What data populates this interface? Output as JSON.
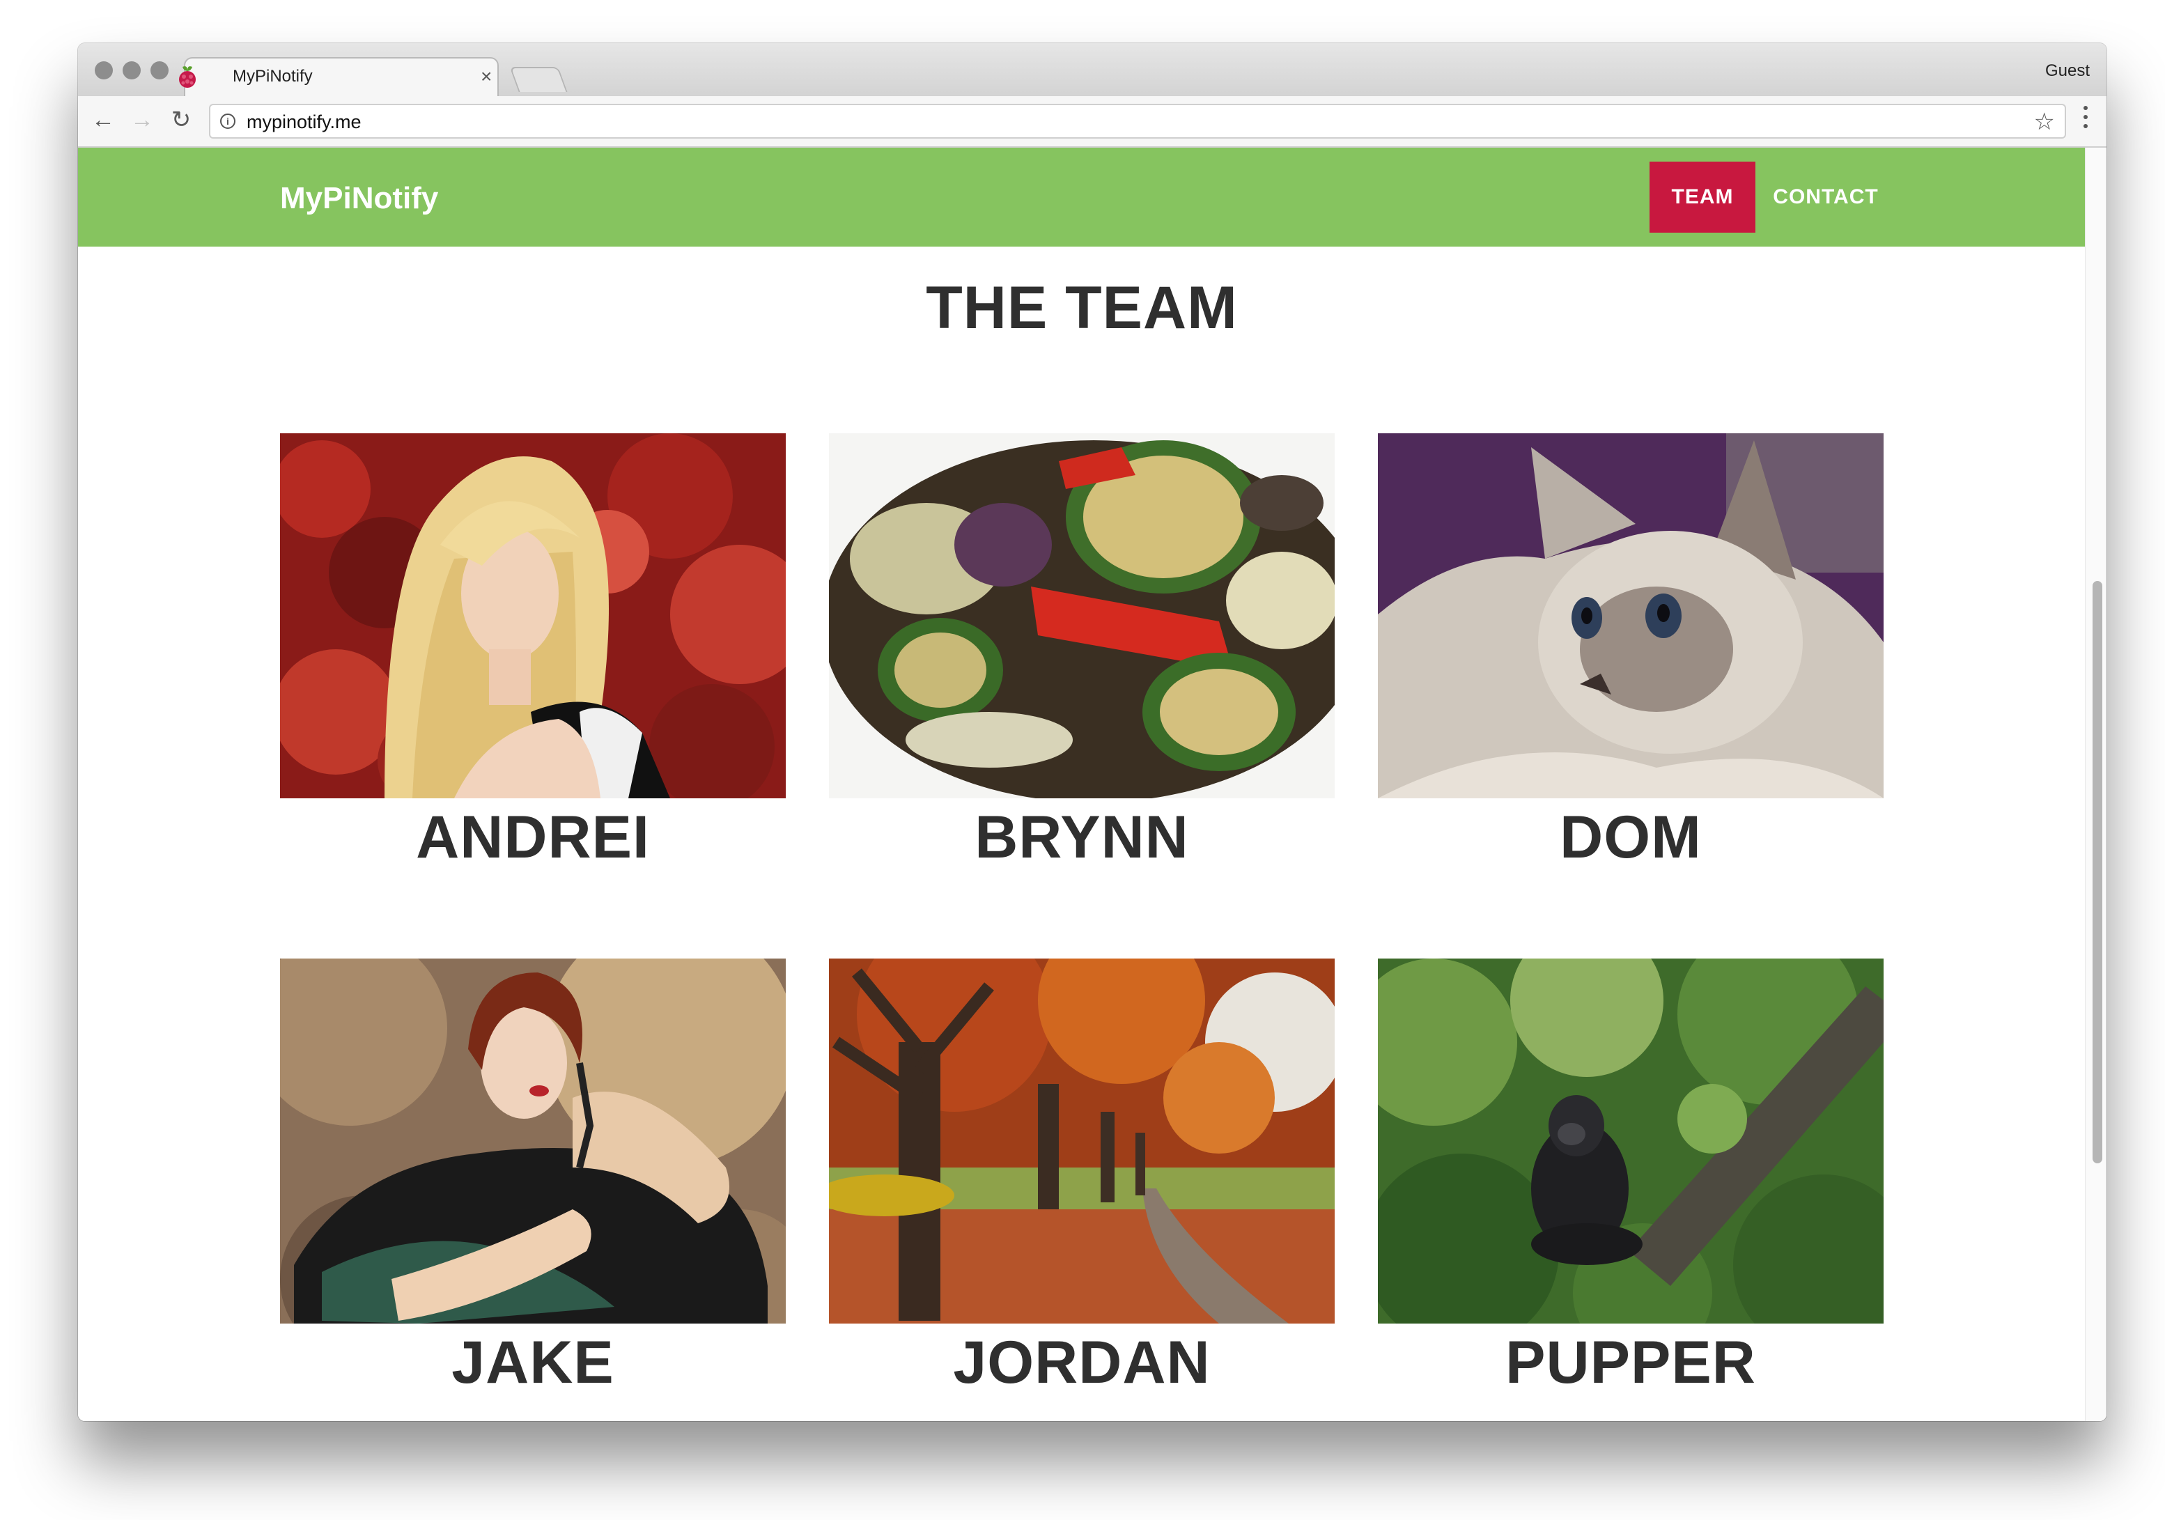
{
  "browser": {
    "tab_title": "MyPiNotify",
    "tab_close": "×",
    "profile": "Guest",
    "url": "mypinotify.me",
    "info_icon": "i",
    "back_glyph": "←",
    "forward_glyph": "→",
    "reload_glyph": "↻",
    "star_glyph": "☆",
    "icons": {
      "back": "back-arrow-icon",
      "forward": "forward-arrow-icon",
      "reload": "reload-icon",
      "info": "info-icon",
      "bookmark": "star-icon",
      "menu": "three-dots-menu-icon",
      "favicon": "raspberry-icon"
    }
  },
  "site": {
    "brand": "MyPiNotify",
    "nav": {
      "team": "TEAM",
      "contact": "CONTACT"
    },
    "section_title": "THE TEAM",
    "colors": {
      "nav_bg": "#86c45f",
      "nav_active": "#c8183f",
      "heading": "#2f2f2f"
    }
  },
  "team": [
    {
      "name": "ANDREI",
      "photo": "blonde-woman-red-ivy-photo"
    },
    {
      "name": "BRYNN",
      "photo": "grilled-vegetables-photo"
    },
    {
      "name": "DOM",
      "photo": "white-cat-photo"
    },
    {
      "name": "JAKE",
      "photo": "woman-dark-dress-photo"
    },
    {
      "name": "JORDAN",
      "photo": "autumn-trees-path-photo"
    },
    {
      "name": "PUPPER",
      "photo": "gorilla-forest-photo"
    }
  ]
}
